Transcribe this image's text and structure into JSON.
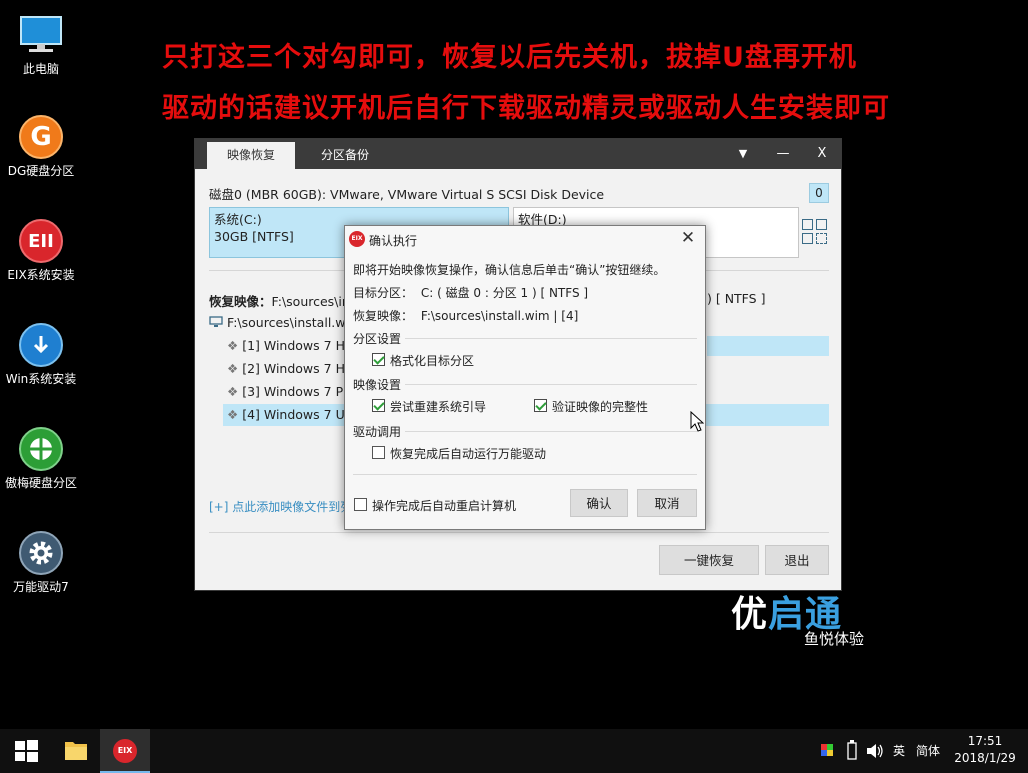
{
  "desktop": {
    "icons": [
      {
        "label": "此电脑"
      },
      {
        "label": "DG硬盘分区"
      },
      {
        "label": "EIX系统安装"
      },
      {
        "label": "Win系统安装"
      },
      {
        "label": "傲梅硬盘分区"
      },
      {
        "label": "万能驱动7"
      }
    ],
    "headline1": "只打这三个对勾即可，恢复以后先关机，拔掉U盘再开机",
    "headline2": "驱动的话建议开机后自行下载驱动精灵或驱动人生安装即可"
  },
  "window": {
    "tabs": [
      {
        "label": "映像恢复",
        "active": true
      },
      {
        "label": "分区备份",
        "active": false
      }
    ],
    "controls": {
      "menu": "▼",
      "minimize": "—",
      "close": "X"
    },
    "disk_title": "磁盘0 (MBR 60GB): VMware, VMware Virtual S SCSI Disk Device",
    "disk_count": "0",
    "partitions": [
      {
        "name": "系统(C:)",
        "info": "30GB [NTFS]"
      },
      {
        "name": "软件(D:)",
        "info": ""
      }
    ],
    "restore_label": "恢复映像：",
    "restore_path": "F:\\sources\\in",
    "restore_right": ") [ NTFS ]",
    "tree_root": "F:\\sources\\install.wir",
    "tree_items": [
      {
        "label": "[1] Windows 7 H"
      },
      {
        "label": "[2] Windows 7 H"
      },
      {
        "label": "[3] Windows 7 Pi"
      },
      {
        "label": "[4] Windows 7 U"
      }
    ],
    "add_link": "[+] 点此添加映像文件到列",
    "btn_restore": "一键恢复",
    "btn_exit": "退出"
  },
  "dialog": {
    "logo_text": "EIX",
    "title": "确认执行",
    "close": "✕",
    "intro": "即将开始映像恢复操作，确认信息后单击“确认”按钮继续。",
    "target_label": "目标分区：",
    "target_value": "C: ( 磁盘 0 : 分区 1 ) [ NTFS ]",
    "image_label": "恢复映像：",
    "image_value": "F:\\sources\\install.wim | [4]",
    "sec_partition": "分区设置",
    "opt_format": "格式化目标分区",
    "sec_image": "映像设置",
    "opt_boot": "尝试重建系统引导",
    "opt_verify": "验证映像的完整性",
    "sec_driver": "驱动调用",
    "opt_driver": "恢复完成后自动运行万能驱动",
    "opt_reboot": "操作完成后自动重启计算机",
    "btn_confirm": "确认",
    "btn_cancel": "取消",
    "checks": {
      "format": true,
      "boot": true,
      "verify": true,
      "driver": false,
      "reboot": false
    }
  },
  "brand": {
    "part1": "优",
    "part2": "启通",
    "sub": "鱼悦体验"
  },
  "taskbar": {
    "app_label": "EIX",
    "lang": "英",
    "ime": "简体",
    "time": "17:51",
    "date": "2018/1/29"
  },
  "colors": {
    "headline": "#e50d0d",
    "selection": "#bfe6f7",
    "titlebar": "#3b3b3b",
    "check": "#2f9e3a"
  }
}
